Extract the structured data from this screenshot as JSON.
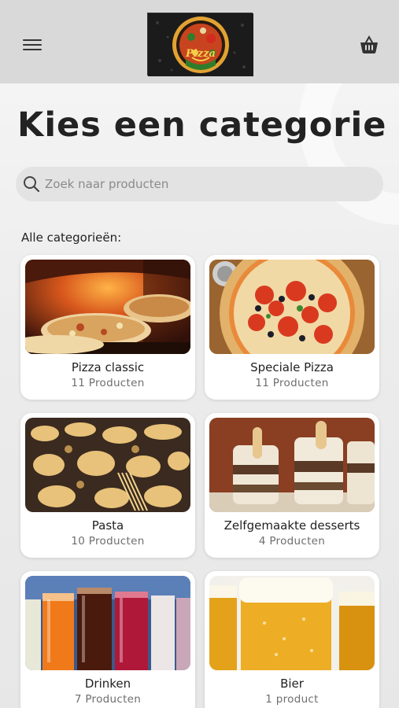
{
  "header": {
    "menu_icon": "hamburger-menu-icon",
    "cart_icon": "basket-icon",
    "logo_text": "Pizza"
  },
  "page": {
    "title": "Kies een categorie",
    "section_label": "Alle categorieën:"
  },
  "search": {
    "placeholder": "Zoek naar producten",
    "icon": "search-icon"
  },
  "categories": [
    {
      "name": "Pizza classic",
      "count": "11 Producten",
      "image": "wood-fired-pizza-photo"
    },
    {
      "name": "Speciale Pizza",
      "count": "11 Producten",
      "image": "pizza-tomato-olive-photo"
    },
    {
      "name": "Pasta",
      "count": "10 Producten",
      "image": "assorted-pasta-photo"
    },
    {
      "name": "Zelfgemaakte desserts",
      "count": "4 Producten",
      "image": "tiramisu-cups-photo"
    },
    {
      "name": "Drinken",
      "count": "7 Producten",
      "image": "colorful-drinks-photo"
    },
    {
      "name": "Bier",
      "count": "1 product",
      "image": "beer-glasses-photo"
    }
  ],
  "colors": {
    "header_bg": "#d9d9d9",
    "page_bg": "#ececec",
    "card_bg": "#ffffff",
    "title_text": "#222222",
    "muted_text": "#6e6e6e"
  }
}
